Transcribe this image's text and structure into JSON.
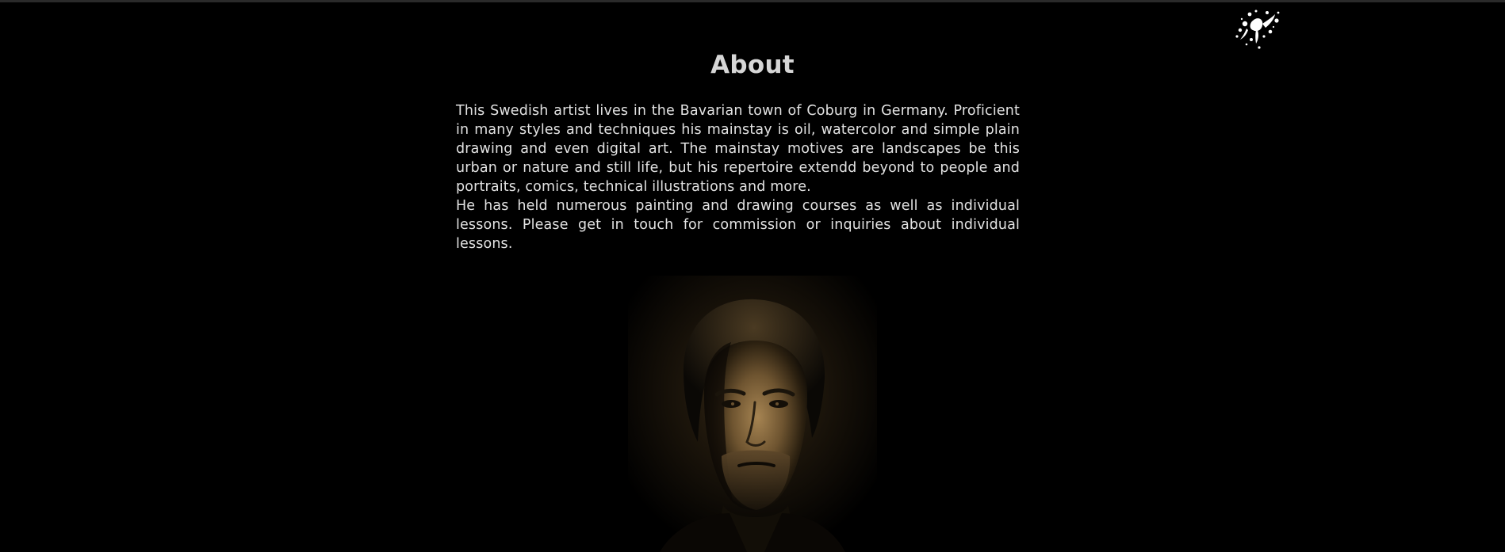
{
  "header": {
    "logo_icon": "paint-splatter-icon",
    "logo_color": "#ffffff"
  },
  "about": {
    "title": "About",
    "paragraphs": [
      "This Swedish artist lives in the Bavarian town of Coburg in Germany. Proficient in many styles and techniques his mainstay is oil, watercolor and simple plain drawing and even digital art. The mainstay motives are landscapes be this urban or nature and still life, but his repertoire extendd beyond to people and portraits, comics, technical illustrations and more.",
      "He has held numerous painting and drawing courses as well as individual lessons. Please get in touch for commission or inquiries about individual lessons."
    ]
  },
  "portrait": {
    "subject": "artist-portrait-photo",
    "tone": "sepia",
    "accent_color": "#a68452"
  },
  "colors": {
    "background": "#000000",
    "title": "#d6d6d6",
    "text": "#e2e2e2"
  }
}
